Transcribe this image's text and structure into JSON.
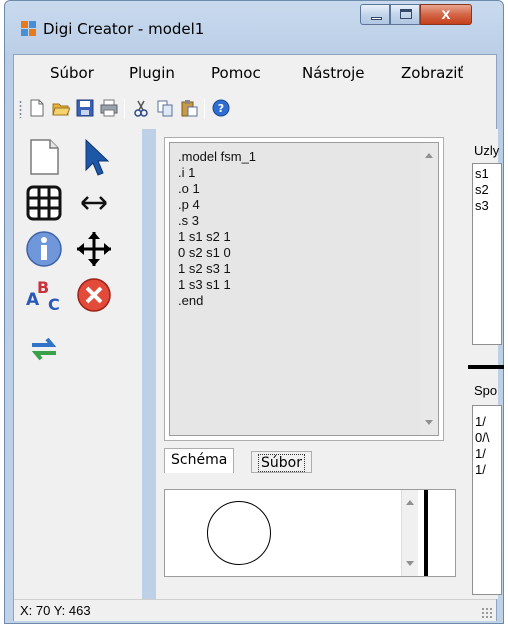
{
  "window": {
    "title": "Digi Creator - model1",
    "close_glyph": "x"
  },
  "menu": {
    "items": [
      "Súbor",
      "Plugin",
      "Pomoc",
      "Nástroje",
      "Zobraziť"
    ]
  },
  "toolbar": {
    "icons": [
      "new-file-icon",
      "open-folder-icon",
      "save-icon",
      "print-icon",
      "cut-icon",
      "copy-icon",
      "paste-icon",
      "help-icon"
    ]
  },
  "palette": {
    "tools": [
      "page-icon",
      "pointer-arrow-icon",
      "grid-icon",
      "horizontal-resize-icon",
      "info-icon",
      "move-icon",
      "spellcheck-icon",
      "delete-icon",
      "refresh-icon"
    ]
  },
  "editor": {
    "lines": [
      ".model fsm_1",
      ".i 1",
      ".o 1",
      ".p 4",
      ".s 3",
      "1 s1 s2 1",
      "0 s2 s1 0",
      "1 s2 s3 1",
      "1 s3 s1 1",
      ".end"
    ],
    "tabs": [
      "Schéma",
      "Súbor"
    ],
    "active_tab": "Súbor"
  },
  "right_panel": {
    "nodes_label": "Uzly",
    "nodes": [
      "s1",
      "s2",
      "s3"
    ],
    "connections_label": "Spo",
    "connections": [
      "1/",
      "0/\\",
      "1/",
      "1/"
    ]
  },
  "status": {
    "coordinates": "X: 70 Y: 463"
  },
  "colors": {
    "frame": "#bfd2e8",
    "close_button": "#d36646",
    "palette_strip": "#bdd0e6",
    "editor_background": "#e6e6e6"
  }
}
